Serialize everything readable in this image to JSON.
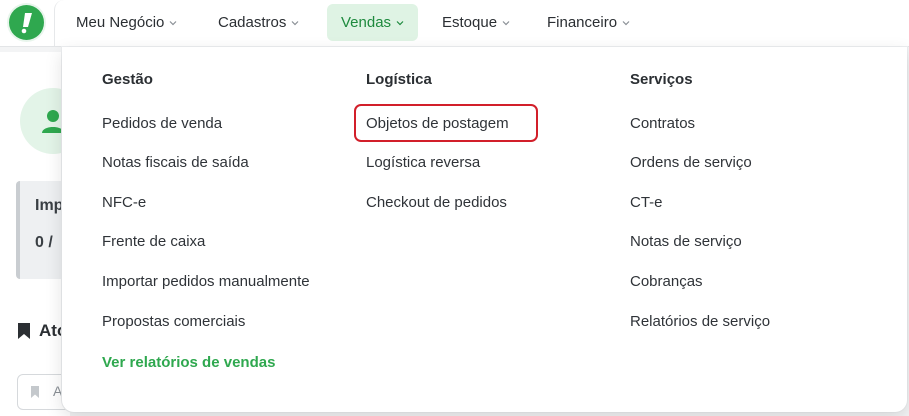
{
  "nav": {
    "items": [
      {
        "label": "Meu Negócio",
        "active": false
      },
      {
        "label": "Cadastros",
        "active": false
      },
      {
        "label": "Vendas",
        "active": true
      },
      {
        "label": "Estoque",
        "active": false
      },
      {
        "label": "Financeiro",
        "active": false
      }
    ]
  },
  "background": {
    "panel_title": "Imp",
    "panel_value": "0 / ",
    "section_title": "Ato",
    "input_text": "A"
  },
  "menu": {
    "columns": [
      {
        "title": "Gestão",
        "items": [
          "Pedidos de venda",
          "Notas fiscais de saída",
          "NFC-e",
          "Frente de caixa",
          "Importar pedidos manualmente",
          "Propostas comerciais"
        ]
      },
      {
        "title": "Logística",
        "items": [
          "Objetos de postagem",
          "Logística reversa",
          "Checkout de pedidos"
        ]
      },
      {
        "title": "Serviços",
        "items": [
          "Contratos",
          "Ordens de serviço",
          "CT-e",
          "Notas de serviço",
          "Cobranças",
          "Relatórios de serviço"
        ]
      }
    ],
    "report_link": "Ver relatórios de vendas",
    "highlighted_item": "Objetos de postagem"
  },
  "colors": {
    "brand_green": "#2fa84f",
    "active_tab_bg": "#dff3e4",
    "highlight_border": "#d21f2a"
  }
}
